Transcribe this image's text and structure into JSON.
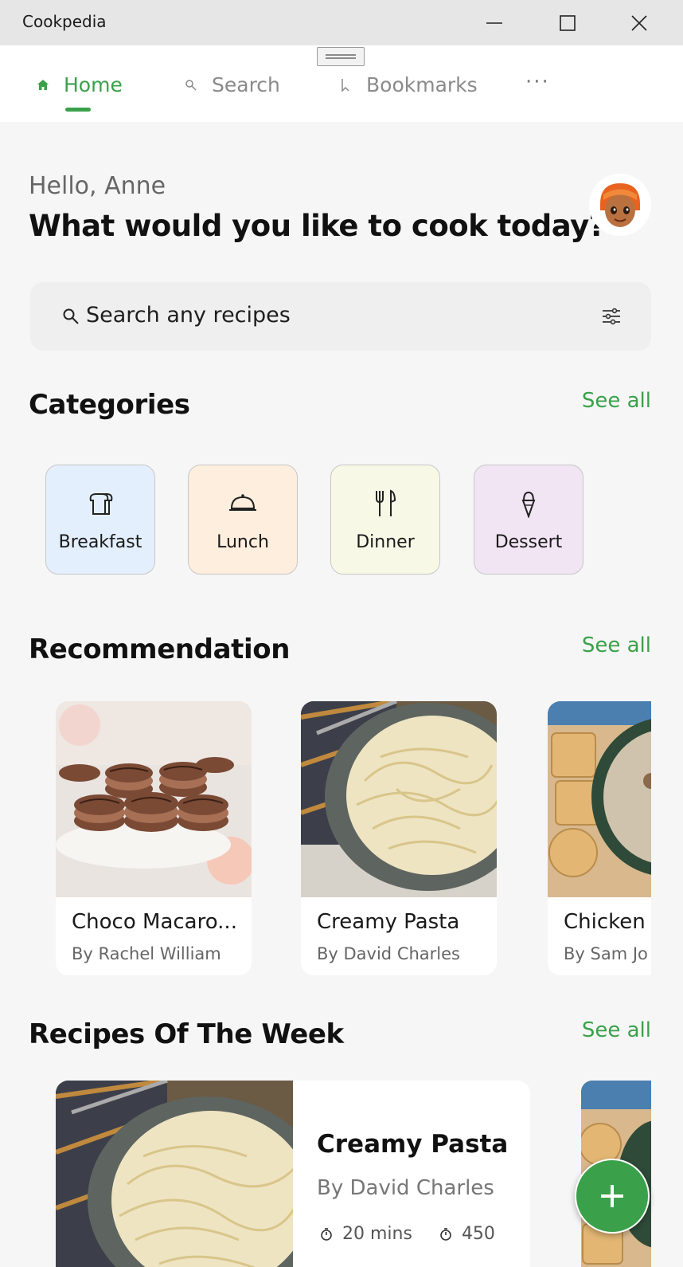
{
  "window": {
    "title": "Cookpedia"
  },
  "nav": {
    "items": [
      {
        "label": "Home",
        "icon": "home-icon",
        "active": true
      },
      {
        "label": "Search",
        "icon": "search-icon",
        "active": false
      },
      {
        "label": "Bookmarks",
        "icon": "bookmark-icon",
        "active": false
      }
    ],
    "more": "···"
  },
  "greeting": {
    "hello": "Hello, Anne",
    "headline": "What would you like to cook today?"
  },
  "search": {
    "placeholder": "Search any recipes",
    "icon": "search-icon",
    "filter_icon": "filter-icon"
  },
  "categories": {
    "title": "Categories",
    "see_all": "See all",
    "items": [
      {
        "label": "Breakfast",
        "icon": "bread-icon",
        "color": "#e3effc"
      },
      {
        "label": "Lunch",
        "icon": "cloche-icon",
        "color": "#fdeedd"
      },
      {
        "label": "Dinner",
        "icon": "cutlery-icon",
        "color": "#f7f9e6"
      },
      {
        "label": "Dessert",
        "icon": "ice-cream-icon",
        "color": "#f1e4f3"
      }
    ]
  },
  "recommendation": {
    "title": "Recommendation",
    "see_all": "See all",
    "items": [
      {
        "title": "Choco Macaro...",
        "author": "By Rachel William"
      },
      {
        "title": "Creamy Pasta",
        "author": "By David Charles"
      },
      {
        "title": "Chicken S",
        "author": "By Sam Jo"
      }
    ]
  },
  "week": {
    "title": "Recipes Of The Week",
    "see_all": "See all",
    "card": {
      "title": "Creamy Pasta",
      "author": "By David Charles",
      "time": "20 mins",
      "calories": "450"
    }
  },
  "fab": {
    "icon": "plus-icon"
  },
  "colors": {
    "accent": "#3aa14a"
  }
}
